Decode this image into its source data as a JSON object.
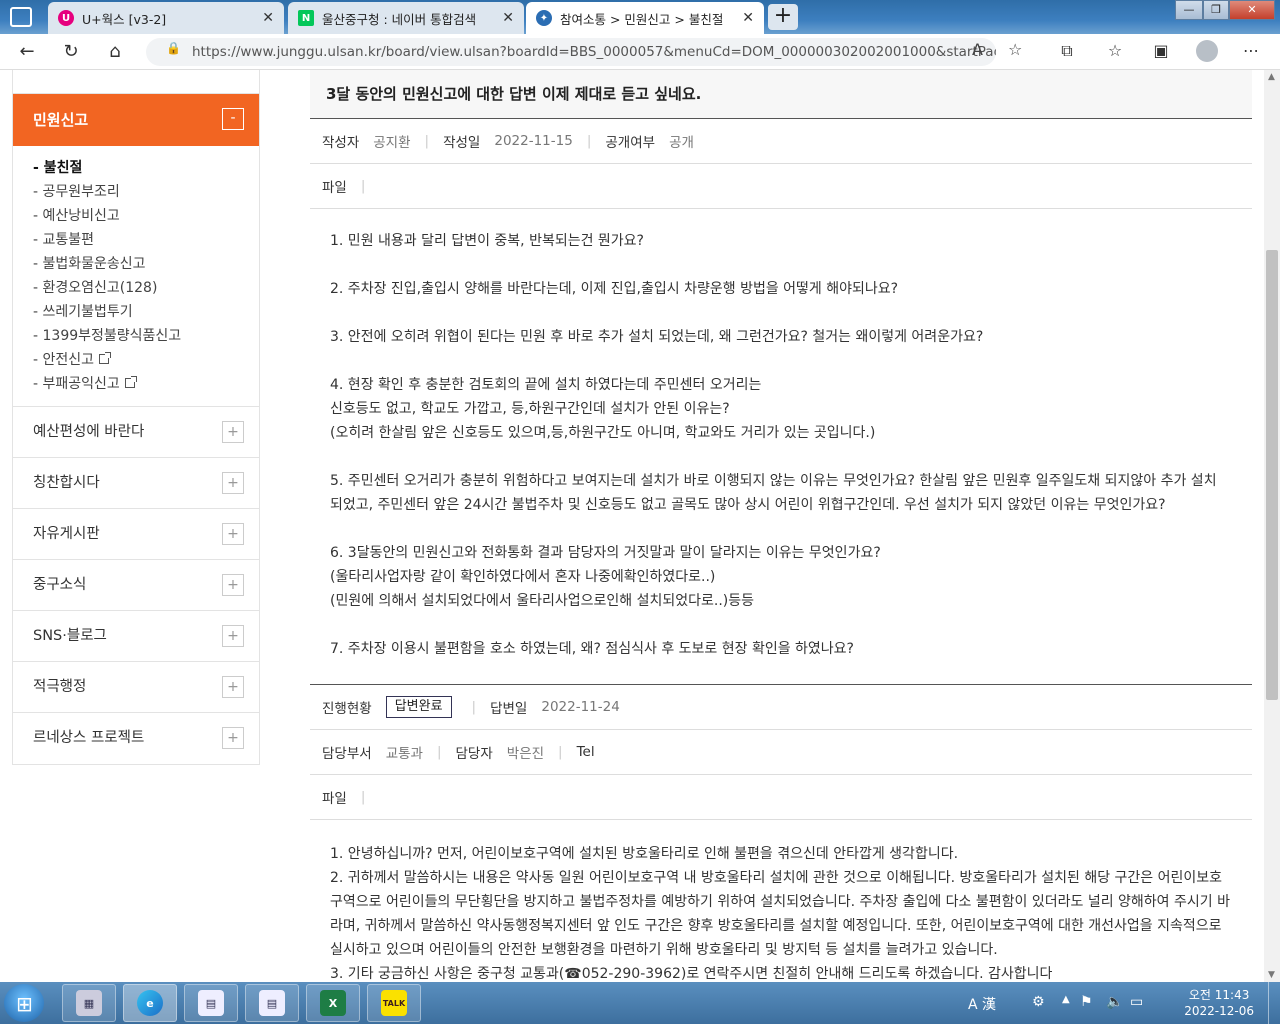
{
  "browser": {
    "tabs": [
      {
        "label": "U+웍스 [v3-2]",
        "icon": "uplus-icon",
        "color": "#e6007e"
      },
      {
        "label": "울산중구청 : 네이버 통합검색",
        "icon": "naver-icon",
        "color": "#03c75a"
      },
      {
        "label": "참여소통 > 민원신고 > 불친절",
        "icon": "junggu-icon",
        "color": "#2b6db3"
      }
    ],
    "url": "https://www.junggu.ulsan.kr/board/view.ulsan?boardId=BBS_0000057&menuCd=DOM_000000302002001000&startPage=..."
  },
  "lnb": {
    "active": "민원신고",
    "active_toggle": "-",
    "subitems": [
      {
        "label": "- 불친절",
        "current": true,
        "ext": false
      },
      {
        "label": "- 공무원부조리",
        "current": false,
        "ext": false
      },
      {
        "label": "- 예산낭비신고",
        "current": false,
        "ext": false
      },
      {
        "label": "- 교통불편",
        "current": false,
        "ext": false
      },
      {
        "label": "- 불법화물운송신고",
        "current": false,
        "ext": false
      },
      {
        "label": "- 환경오염신고(128)",
        "current": false,
        "ext": false
      },
      {
        "label": "- 쓰레기불법투기",
        "current": false,
        "ext": false
      },
      {
        "label": "- 1399부정불량식품신고",
        "current": false,
        "ext": false
      },
      {
        "label": "- 안전신고",
        "current": false,
        "ext": true
      },
      {
        "label": "- 부패공익신고",
        "current": false,
        "ext": true
      }
    ],
    "items": [
      "예산편성에 바란다",
      "칭찬합시다",
      "자유게시판",
      "중구소식",
      "SNS·블로그",
      "적극행정",
      "르네상스 프로젝트"
    ],
    "toggle": "+"
  },
  "post": {
    "title": "3달 동안의 민원신고에 대한 답변 이제 제대로 듣고 싶네요.",
    "author_label": "작성자",
    "author": "공지환",
    "date_label": "작성일",
    "date": "2022-11-15",
    "public_label": "공개여부",
    "public": "공개",
    "file_label": "파일",
    "sep": "|",
    "question": [
      "1. 민원 내용과 달리 답변이 중복, 반복되는건 뭔가요?",
      "",
      "2. 주차장 진입,출입시 양해를 바란다는데, 이제 진입,출입시 차량운행 방법을 어떻게 해야되나요?",
      "",
      "3. 안전에 오히려 위협이 된다는 민원 후 바로 추가 설치 되었는데, 왜 그런건가요? 철거는 왜이렇게 어려운가요?",
      "",
      "4. 현장 확인 후 충분한 검토회의 끝에 설치 하였다는데 주민센터 오거리는",
      "신호등도 없고, 학교도 가깝고, 등,하원구간인데 설치가 안된 이유는?",
      "(오히려 한살림 앞은 신호등도 있으며,등,하원구간도 아니며, 학교와도 거리가 있는 곳입니다.)",
      "",
      "5. 주민센터 오거리가 충분히 위험하다고 보여지는데 설치가 바로 이행되지 않는 이유는 무엇인가요? 한살림 앞은 민원후 일주일도채 되지않아 추가 설치 되었고, 주민센터 앞은 24시간 불법주차 및 신호등도 없고 골목도 많아 상시 어린이 위협구간인데. 우선 설치가 되지 않았던 이유는 무엇인가요?",
      "",
      "6. 3달동안의 민원신고와 전화통화 결과 담당자의 거짓말과 말이 달라지는 이유는 무엇인가요?",
      "(울타리사업자랑 같이 확인하였다에서 혼자 나중에확인하였다로..)",
      "(민원에 의해서 설치되었다에서 울타리사업으로인해 설치되었다로..)등등",
      "",
      "7. 주차장 이용시 불편함을 호소 하였는데, 왜? 점심식사 후 도보로 현장 확인을 하였나요?"
    ]
  },
  "answer": {
    "status_label": "진행현황",
    "status": "답변완료",
    "date_label": "답변일",
    "date": "2022-11-24",
    "dept_label": "담당부서",
    "dept": "교통과",
    "person_label": "담당자",
    "person": "박은진",
    "tel_label": "Tel",
    "file_label": "파일",
    "body": [
      "1. 안녕하십니까? 먼저, 어린이보호구역에 설치된 방호울타리로 인해 불편을 겪으신데 안타깝게 생각합니다.",
      "2. 귀하께서 말씀하시는 내용은 약사동 일원 어린이보호구역 내 방호울타리 설치에 관한 것으로 이해됩니다. 방호울타리가 설치된 해당 구간은 어린이보호구역으로 어린이들의 무단횡단을 방지하고 불법주정차를 예방하기 위하여 설치되었습니다. 주차장 출입에 다소 불편함이 있더라도 널리 양해하여 주시기 바라며, 귀하께서 말씀하신 약사동행정복지센터 앞 인도 구간은 향후 방호울타리를 설치할 예정입니다. 또한, 어린이보호구역에 대한 개선사업을 지속적으로 실시하고 있으며 어린이들의 안전한 보행환경을 마련하기 위해 방호울타리 및 방지턱 등 설치를 늘려가고 있습니다.",
      "3. 기타 궁금하신 사항은 중구청 교통과(☎052-290-3962)로 연락주시면 친절히 안내해 드리도록 하겠습니다. 감사합니다"
    ]
  },
  "taskbar": {
    "time": "오전 11:43",
    "date": "2022-12-06",
    "ime": "A 漢",
    "kakao": "TALK"
  },
  "colors": {
    "accent": "#f26522",
    "line": "#555555"
  }
}
